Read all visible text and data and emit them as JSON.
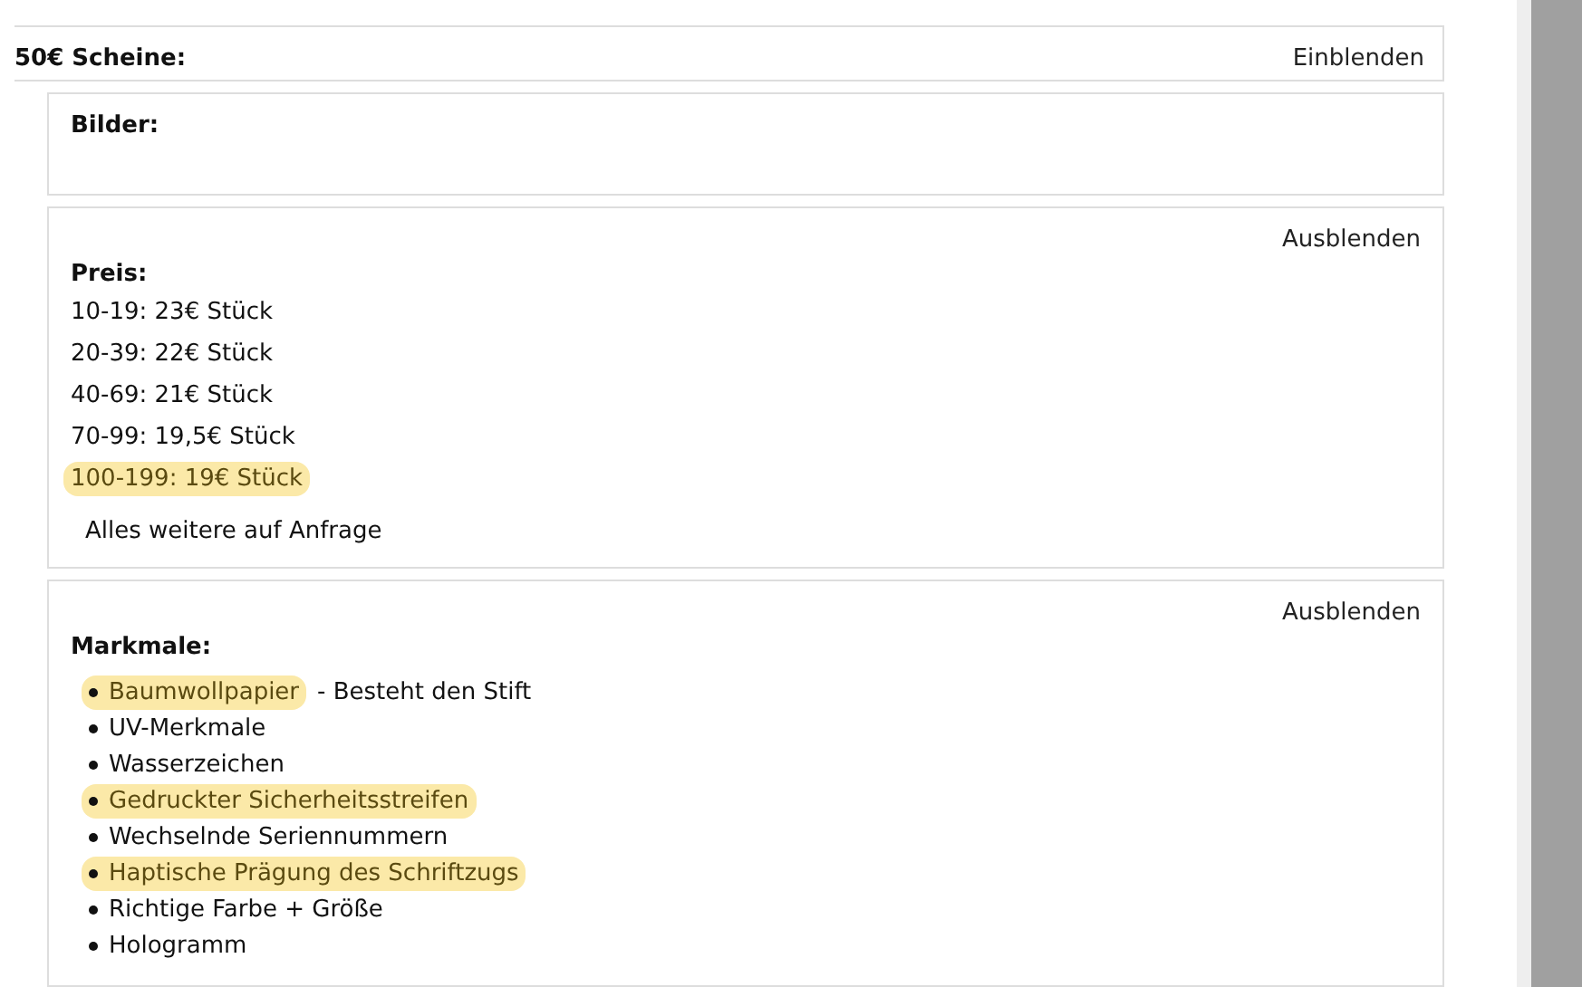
{
  "header": {
    "title": "50€ Scheine:",
    "toggle": "Einblenden"
  },
  "sections": [
    {
      "kind": "empty",
      "title": "Bilder:"
    },
    {
      "kind": "prices",
      "toggle": "Ausblenden",
      "title": "Preis:",
      "items": [
        {
          "text": "10-19: 23€ Stück",
          "highlighted": false
        },
        {
          "text": "20-39: 22€ Stück",
          "highlighted": false
        },
        {
          "text": "40-69: 21€ Stück",
          "highlighted": false
        },
        {
          "text": "70-99: 19,5€ Stück",
          "highlighted": false
        },
        {
          "text": "100-199: 19€ Stück",
          "highlighted": true
        }
      ],
      "note": "Alles weitere auf Anfrage"
    },
    {
      "kind": "bullets",
      "toggle": "Ausblenden",
      "title": "Markmale:",
      "items": [
        {
          "text": "Baumwollpapier",
          "suffix": "- Besteht den Stift",
          "highlighted": true
        },
        {
          "text": "UV-Merkmale",
          "highlighted": false
        },
        {
          "text": "Wasserzeichen",
          "highlighted": false
        },
        {
          "text": "Gedruckter Sicherheitsstreifen",
          "highlighted": true
        },
        {
          "text": "Wechselnde Seriennummern",
          "highlighted": false
        },
        {
          "text": "Haptische Prägung des Schriftzugs",
          "highlighted": true
        },
        {
          "text": "Richtige Farbe + Größe",
          "highlighted": false
        },
        {
          "text": "Hologramm",
          "highlighted": false
        }
      ]
    }
  ]
}
